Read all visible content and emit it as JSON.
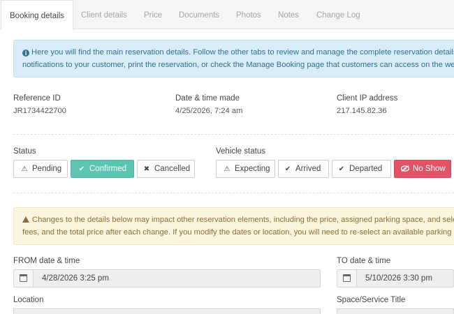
{
  "tabs": [
    {
      "label": "Booking details",
      "active": true
    },
    {
      "label": "Client details"
    },
    {
      "label": "Price"
    },
    {
      "label": "Documents"
    },
    {
      "label": "Photos"
    },
    {
      "label": "Notes"
    },
    {
      "label": "Change Log"
    }
  ],
  "info": {
    "line1": "Here you will find the main reservation details. Follow the other tabs to review and manage the complete reservation details. Use",
    "line2": "notifications to your customer, print the reservation, or check the Manage Booking page that customers can access on the website."
  },
  "details": {
    "reference_label": "Reference ID",
    "reference_value": "JR1734422700",
    "made_label": "Date & time made",
    "made_value": "4/25/2026, 7:24 am",
    "ip_label": "Client IP address",
    "ip_value": "217.145.82.36"
  },
  "status": {
    "label": "Status",
    "buttons": [
      {
        "label": "Pending",
        "icon": "warning-icon"
      },
      {
        "label": "Confirmed",
        "icon": "check-icon",
        "selected": true
      },
      {
        "label": "Cancelled",
        "icon": "close-icon"
      }
    ]
  },
  "vehicle_status": {
    "label": "Vehicle status",
    "buttons": [
      {
        "label": "Expecting",
        "icon": "warning-icon"
      },
      {
        "label": "Arrived",
        "icon": "check-icon"
      },
      {
        "label": "Departed",
        "icon": "check-icon"
      },
      {
        "label": "No Show",
        "icon": "eye-slash-icon",
        "selected": true
      }
    ]
  },
  "warning": {
    "line1": "Changes to the details below may impact other reservation elements, including the price, assigned parking space, and selected ex",
    "line2": "fees, and the total price after each change. If you modify the dates or location, you will need to re-select an available parking space."
  },
  "from": {
    "label": "FROM date & time",
    "value": "4/28/2026 3:25 pm"
  },
  "to": {
    "label": "TO date & time",
    "value": "5/10/2026 3:30 pm"
  },
  "location": {
    "label": "Location"
  },
  "space": {
    "label": "Space/Service Title"
  },
  "colors": {
    "confirmed": "#5bc5b1",
    "no_show": "#e35366",
    "info_bg": "#d8edf8",
    "warning_bg": "#fcf5dd"
  }
}
